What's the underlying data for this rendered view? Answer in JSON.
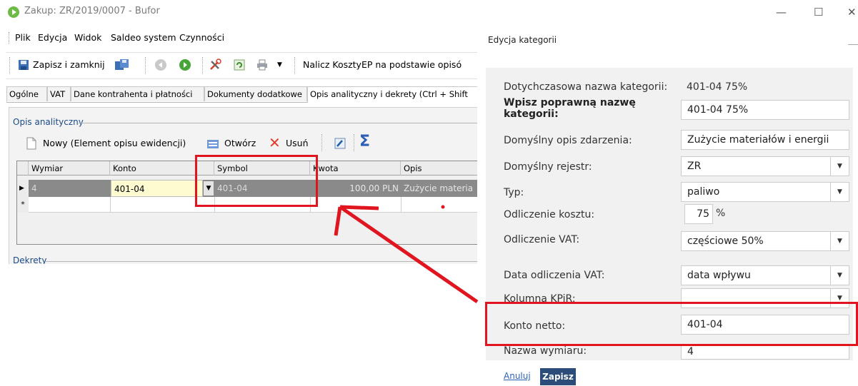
{
  "window": {
    "title": "Zakup: ZR/2019/0007 - Bufor",
    "controls": {
      "minimize": "—",
      "maximize": "☐",
      "close": "✕"
    }
  },
  "menu": [
    "Plik",
    "Edycja",
    "Widok",
    "Saldeo system",
    "Czynności"
  ],
  "toolbar": {
    "save_close_label": "Zapisz i zamknij",
    "calc_label": "Nalicz KosztyEP na podstawie opisó"
  },
  "tabs": [
    "Ogólne",
    "VAT",
    "Dane kontrahenta i płatności",
    "Dokumenty dodatkowe",
    "Opis analityczny i dekrety (Ctrl + Shift"
  ],
  "analytic": {
    "group_label": "Opis analityczny",
    "new_label": "Nowy (Element opisu ewidencji)",
    "open_label": "Otwórz",
    "delete_label": "Usuń",
    "sum_symbol": "Σ"
  },
  "grid": {
    "columns": [
      "Wymiar",
      "Konto",
      "Symbol",
      "Kwota",
      "Opis"
    ],
    "rows": [
      {
        "indicator": "▶",
        "wymiar": "4",
        "konto": "401-04",
        "symbol": "401-04",
        "kwota": "100,00 PLN",
        "opis": "Zużycie materia"
      }
    ],
    "new_row_indicator": "*"
  },
  "decrees": {
    "group_label": "Dekrety"
  },
  "dialog": {
    "title": "Edycja kategorii",
    "current_name_label": "Dotychczasowa nazwa kategorii:",
    "current_name_value": "401-04 75%",
    "correct_name_label": "Wpisz poprawną nazwę kategorii:",
    "correct_name_value": "401-04 75%",
    "default_desc_label": "Domyślny opis zdarzenia:",
    "default_desc_value": "Zużycie materiałów i energii",
    "default_register_label": "Domyślny rejestr:",
    "default_register_value": "ZR",
    "type_label": "Typ:",
    "type_value": "paliwo",
    "cost_deduction_label": "Odliczenie kosztu:",
    "cost_deduction_value": "75",
    "cost_deduction_unit": "%",
    "vat_deduction_label": "Odliczenie VAT:",
    "vat_deduction_value": "częściowe 50%",
    "vat_date_label": "Data odliczenia VAT:",
    "vat_date_value": "data wpływu",
    "kpir_label": "Kolumna KPiR:",
    "net_account_label": "Konto netto:",
    "net_account_value": "401-04",
    "dimension_label": "Nazwa wymiaru:",
    "dimension_value": "4",
    "cancel_label": "Anuluj",
    "save_label": "Zapisz"
  },
  "colors": {
    "annotation_red": "#e0151f",
    "save_button": "#2c4d7a",
    "link_blue": "#2a62b8",
    "selected_row": "#8a8a8a"
  }
}
